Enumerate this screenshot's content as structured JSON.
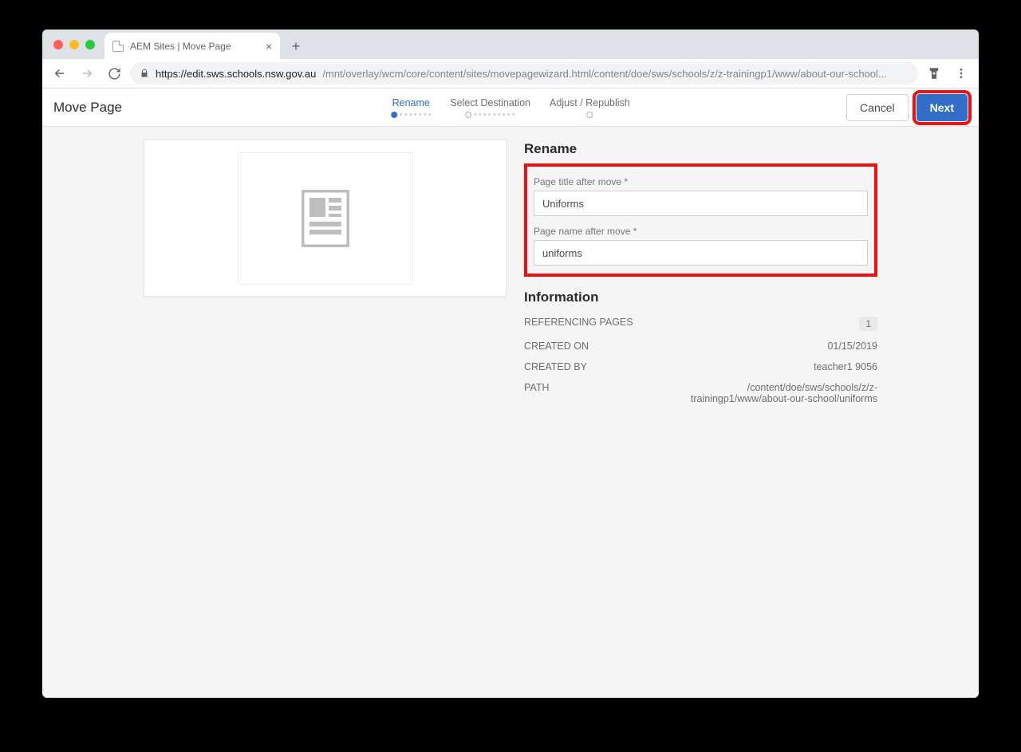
{
  "browser": {
    "tab_title": "AEM Sites | Move Page",
    "url_host": "https://edit.sws.schools.nsw.gov.au",
    "url_rest": "/mnt/overlay/wcm/core/content/sites/movepagewizard.html/content/doe/sws/schools/z/z-trainingp1/www/about-our-school..."
  },
  "header": {
    "title": "Move Page",
    "steps": [
      "Rename",
      "Select Destination",
      "Adjust / Republish"
    ],
    "active_step_index": 0,
    "cancel_label": "Cancel",
    "next_label": "Next"
  },
  "rename": {
    "heading": "Rename",
    "title_label": "Page title after move *",
    "title_value": "Uniforms",
    "name_label": "Page name after move *",
    "name_value": "uniforms"
  },
  "information": {
    "heading": "Information",
    "rows": {
      "referencing_pages_label": "REFERENCING PAGES",
      "referencing_pages_value": "1",
      "created_on_label": "CREATED ON",
      "created_on_value": "01/15/2019",
      "created_by_label": "CREATED BY",
      "created_by_value": "teacher1 9056",
      "path_label": "PATH",
      "path_value": "/content/doe/sws/schools/z/z-trainingp1/www/about-our-school/uniforms"
    }
  }
}
